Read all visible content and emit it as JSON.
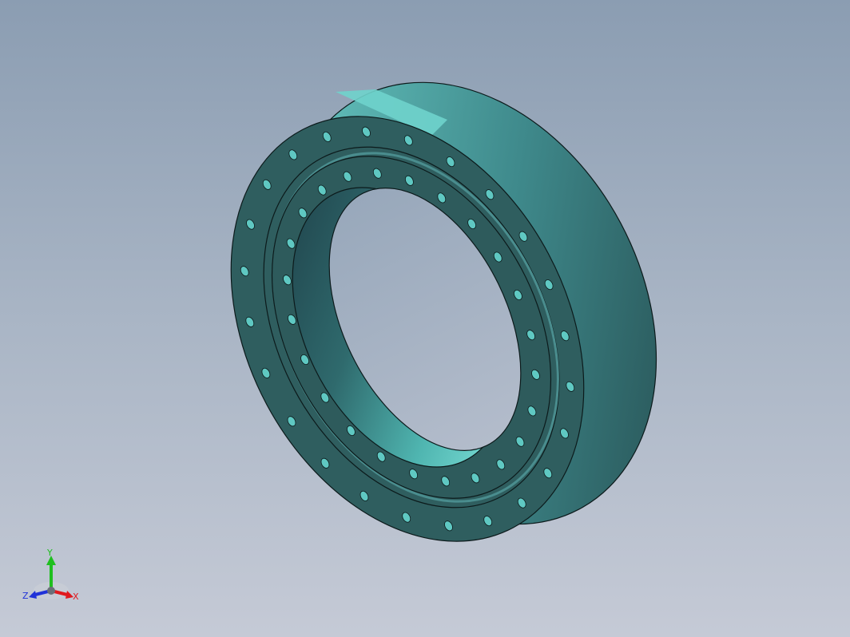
{
  "colors": {
    "background_top": "#8b9db2",
    "background_bottom": "#c5cad6",
    "part_face": "#2f5e5f",
    "part_highlight": "#6fd3cc",
    "hole_fill": "#5fc8c2",
    "axis_x": "#e0191e",
    "axis_y": "#1fbf1f",
    "axis_z": "#2032d8"
  },
  "model": {
    "part_type": "flanged bearing ring",
    "outer_hole_count": 24,
    "inner_hole_count": 24
  },
  "triad": {
    "x_label": "X",
    "y_label": "Y",
    "z_label": "Z"
  }
}
